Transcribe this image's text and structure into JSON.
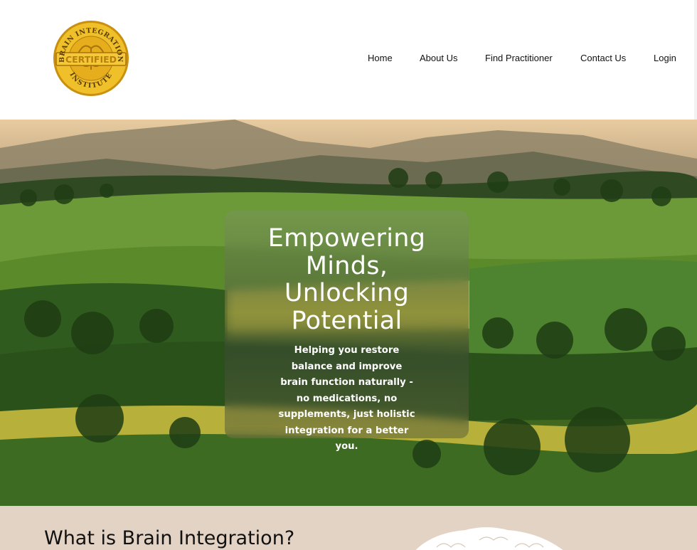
{
  "logo": {
    "top_text": "BRAIN INTEGRATION",
    "middle_text": "CERTIFIED",
    "bottom_text": "INSTITUTE"
  },
  "nav": {
    "items": [
      "Home",
      "About Us",
      "Find Practitioner",
      "Contact Us",
      "Login"
    ]
  },
  "hero": {
    "heading": "Empowering Minds, Unlocking Potential",
    "body": "Helping you restore balance and improve brain function naturally - no medications, no supplements, just holistic integration for a better you."
  },
  "section": {
    "heading": "What is Brain Integration?"
  },
  "colors": {
    "section_bg": "#e3d3c4",
    "logo_gold": "#e8b21a",
    "card_text": "#ffffff"
  }
}
